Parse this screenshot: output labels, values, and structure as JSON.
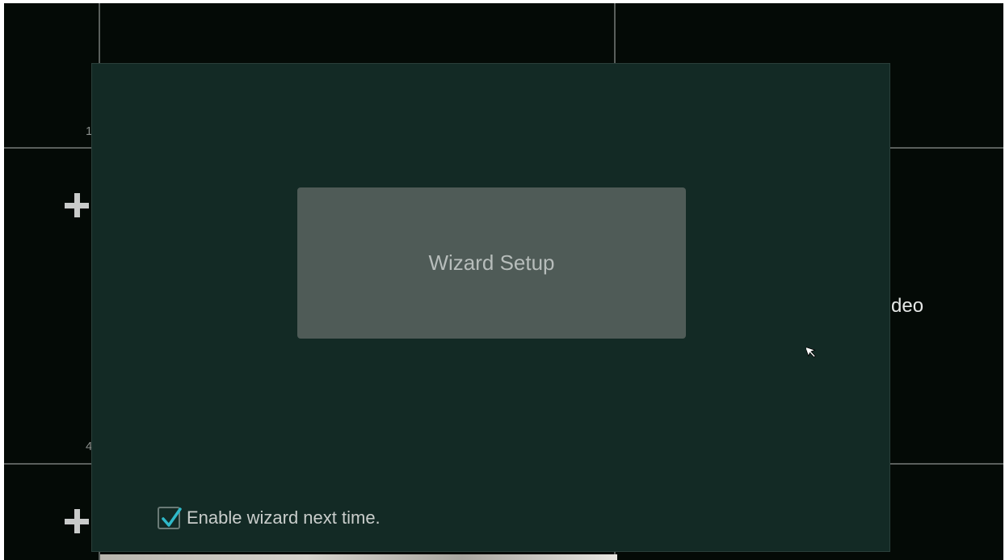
{
  "background": {
    "cell_numbers": [
      "1",
      "4"
    ],
    "partial_text": "deo"
  },
  "dialog": {
    "wizard_button_label": "Wizard Setup",
    "enable_wizard_label": "Enable wizard next time.",
    "enable_wizard_checked": true
  },
  "colors": {
    "dialog_bg": "#132a25",
    "button_bg": "#4f5b57",
    "checkmark": "#2fb9c9"
  }
}
